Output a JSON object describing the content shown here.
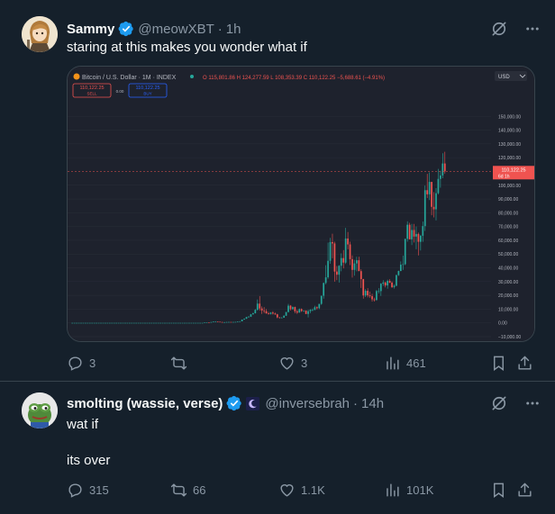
{
  "tweets": [
    {
      "display_name": "Sammy",
      "handle": "@meowXBT",
      "time": "1h",
      "text": "staring at this makes you wonder what if",
      "actions": {
        "replies": "3",
        "retweets": "",
        "likes": "3",
        "views": "461"
      }
    },
    {
      "display_name": "smolting (wassie, verse)",
      "handle": "@inversebrah",
      "time": "14h",
      "text": "wat if\n\nits over",
      "actions": {
        "replies": "315",
        "retweets": "66",
        "likes": "1.1K",
        "views": "101K"
      }
    }
  ],
  "chart_embed": {
    "symbol": "Bitcoin / U.S. Dollar · 1M · INDEX",
    "ohlc": "O 115,801.86  H 124,277.59  L 108,353.39  C 110,122.25  −5,688.61 (−4.91%)",
    "sell_price": "110,122.25",
    "sell_label": "SELL",
    "spread": "0.00",
    "buy_price": "110,122.25",
    "buy_label": "BUY",
    "currency": "USD",
    "current_price_label": "110,122.25",
    "countdown": "6d 1h",
    "y_ticks": [
      "150,000.00",
      "140,000.00",
      "130,000.00",
      "120,000.00",
      "100,000.00",
      "90,000.00",
      "80,000.00",
      "70,000.00",
      "60,000.00",
      "50,000.00",
      "40,000.00",
      "30,000.00",
      "20,000.00",
      "10,000.00",
      "0.00",
      "−10,000.00"
    ]
  },
  "chart_data": {
    "type": "candlestick",
    "title": "Bitcoin / U.S. Dollar · 1M · INDEX",
    "ylim": [
      -10000,
      160000
    ],
    "y_ticks": [
      150000,
      140000,
      130000,
      120000,
      100000,
      90000,
      80000,
      70000,
      60000,
      50000,
      40000,
      30000,
      20000,
      10000,
      0,
      -10000
    ],
    "current_price": 110122.25,
    "candles": [
      [
        0,
        0,
        0,
        0
      ],
      [
        0,
        0,
        0,
        0
      ],
      [
        0,
        0,
        0,
        0
      ],
      [
        0,
        0,
        0,
        0
      ],
      [
        0,
        0,
        0,
        0
      ],
      [
        0,
        0,
        0,
        0
      ],
      [
        0,
        0,
        0,
        0
      ],
      [
        0,
        0,
        0,
        0
      ],
      [
        0,
        0,
        0,
        0
      ],
      [
        0,
        0,
        0,
        0
      ],
      [
        0,
        0,
        0,
        0
      ],
      [
        0,
        0,
        0,
        0
      ],
      [
        0,
        0,
        0,
        0
      ],
      [
        0,
        0,
        0,
        0
      ],
      [
        0,
        0,
        0,
        0
      ],
      [
        0,
        0,
        0,
        0
      ],
      [
        0,
        0,
        0,
        0
      ],
      [
        0,
        0,
        0,
        0
      ],
      [
        0,
        0,
        0,
        0
      ],
      [
        0,
        0,
        0,
        0
      ],
      [
        0,
        0,
        0,
        0
      ],
      [
        0,
        0,
        0,
        0
      ],
      [
        0,
        0,
        0,
        0
      ],
      [
        0,
        0,
        0,
        0
      ],
      [
        0,
        0,
        0,
        0
      ],
      [
        0,
        0,
        0,
        0
      ],
      [
        0,
        0,
        0,
        0
      ],
      [
        0,
        0,
        0,
        0
      ],
      [
        0,
        0,
        0,
        0
      ],
      [
        0,
        0,
        0,
        0
      ],
      [
        0,
        0,
        0,
        0
      ],
      [
        0,
        0,
        0,
        0
      ],
      [
        0,
        0,
        0,
        0
      ],
      [
        0,
        0,
        0,
        0
      ],
      [
        0,
        0,
        0,
        0
      ],
      [
        0,
        0,
        0,
        0
      ],
      [
        0,
        0,
        0,
        0
      ],
      [
        0,
        0,
        0,
        0
      ],
      [
        0,
        0,
        0,
        0
      ],
      [
        0,
        0,
        0,
        0
      ],
      [
        0,
        0,
        0,
        0
      ],
      [
        0,
        0,
        0,
        0
      ],
      [
        0,
        0,
        0,
        0
      ],
      [
        0,
        0,
        0,
        0
      ],
      [
        0,
        0,
        0,
        0
      ],
      [
        0,
        0,
        0,
        0
      ],
      [
        0,
        0,
        0,
        0
      ],
      [
        0,
        0,
        0,
        0
      ],
      [
        0,
        0,
        0,
        0
      ],
      [
        0,
        0,
        0,
        0
      ],
      [
        0,
        0,
        0,
        0
      ],
      [
        0,
        0,
        0,
        0
      ],
      [
        0,
        0,
        0,
        0
      ],
      [
        0,
        0,
        0,
        0
      ],
      [
        0,
        0,
        0,
        0
      ],
      [
        0,
        0,
        0,
        0
      ],
      [
        0,
        0,
        0,
        0
      ],
      [
        0,
        0,
        0,
        0
      ],
      [
        0,
        0,
        0,
        0
      ],
      [
        0,
        0,
        0,
        0
      ],
      [
        300,
        300,
        300,
        300
      ],
      [
        300,
        400,
        300,
        400
      ],
      [
        400,
        450,
        300,
        350
      ],
      [
        350,
        700,
        350,
        600
      ],
      [
        600,
        1000,
        500,
        900
      ],
      [
        900,
        1200,
        800,
        1000
      ],
      [
        1000,
        1100,
        700,
        800
      ],
      [
        800,
        900,
        500,
        600
      ],
      [
        600,
        700,
        400,
        500
      ],
      [
        500,
        600,
        400,
        500
      ],
      [
        500,
        700,
        400,
        600
      ],
      [
        600,
        700,
        500,
        650
      ],
      [
        650,
        700,
        550,
        600
      ],
      [
        600,
        700,
        550,
        650
      ],
      [
        650,
        800,
        600,
        700
      ],
      [
        700,
        1000,
        650,
        950
      ],
      [
        950,
        1200,
        900,
        1150
      ],
      [
        1150,
        2500,
        1100,
        2400
      ],
      [
        2400,
        3200,
        2300,
        3000
      ],
      [
        3000,
        4500,
        2900,
        4200
      ],
      [
        4200,
        5000,
        3800,
        4500
      ],
      [
        4500,
        6500,
        4300,
        6200
      ],
      [
        6200,
        7500,
        6000,
        7000
      ],
      [
        7000,
        10000,
        6800,
        9500
      ],
      [
        9500,
        17000,
        9000,
        14000
      ],
      [
        14000,
        19500,
        9000,
        10500
      ],
      [
        10500,
        12000,
        6500,
        9000
      ],
      [
        9000,
        11500,
        7000,
        8500
      ],
      [
        8500,
        10000,
        6500,
        7000
      ],
      [
        7000,
        8000,
        6000,
        6500
      ],
      [
        6500,
        7800,
        6000,
        7500
      ],
      [
        7500,
        8500,
        6000,
        6800
      ],
      [
        6800,
        7500,
        5800,
        6200
      ],
      [
        6200,
        6600,
        3400,
        4000
      ],
      [
        4000,
        4200,
        3200,
        3700
      ],
      [
        3700,
        4200,
        3400,
        3800
      ],
      [
        3800,
        5500,
        3700,
        5200
      ],
      [
        5200,
        8000,
        5000,
        7900
      ],
      [
        7900,
        13800,
        7600,
        12500
      ],
      [
        12500,
        13000,
        9000,
        10000
      ],
      [
        10000,
        12000,
        9500,
        11500
      ],
      [
        11500,
        11800,
        7000,
        8400
      ],
      [
        8400,
        9500,
        6500,
        7500
      ],
      [
        7500,
        10500,
        7400,
        10000
      ],
      [
        10000,
        10500,
        8000,
        8600
      ],
      [
        8600,
        9200,
        8100,
        8900
      ],
      [
        8900,
        9200,
        6500,
        6500
      ],
      [
        6500,
        9500,
        4000,
        8500
      ],
      [
        8500,
        10000,
        7000,
        9500
      ],
      [
        9500,
        10500,
        8500,
        9500
      ],
      [
        9500,
        12500,
        9100,
        11400
      ],
      [
        11400,
        12000,
        9800,
        10700
      ],
      [
        10700,
        13800,
        10000,
        13800
      ],
      [
        13800,
        19800,
        13100,
        19700
      ],
      [
        19700,
        29300,
        17600,
        29000
      ],
      [
        29000,
        41900,
        28000,
        33100
      ],
      [
        33100,
        58300,
        32000,
        45100
      ],
      [
        45100,
        61800,
        43000,
        58700
      ],
      [
        58700,
        64800,
        47000,
        57700
      ],
      [
        57700,
        59000,
        30000,
        37300
      ],
      [
        37300,
        41300,
        31000,
        35000
      ],
      [
        35000,
        42000,
        29300,
        41500
      ],
      [
        41500,
        50500,
        37500,
        47100
      ],
      [
        47100,
        52900,
        39600,
        43800
      ],
      [
        43800,
        69000,
        42800,
        61300
      ],
      [
        61300,
        66000,
        53500,
        57000
      ],
      [
        57000,
        59000,
        42000,
        46300
      ],
      [
        46300,
        49000,
        32900,
        38500
      ],
      [
        38500,
        45800,
        34300,
        43200
      ],
      [
        43200,
        48000,
        37500,
        45500
      ],
      [
        45500,
        48000,
        37700,
        37600
      ],
      [
        37600,
        39000,
        25400,
        31800
      ],
      [
        31800,
        32000,
        17600,
        19900
      ],
      [
        19900,
        24600,
        18800,
        23300
      ],
      [
        23300,
        25200,
        18500,
        20000
      ],
      [
        20000,
        22800,
        18200,
        19400
      ],
      [
        19400,
        21100,
        15500,
        17100
      ],
      [
        17100,
        18400,
        15500,
        16500
      ],
      [
        16500,
        23900,
        16500,
        23100
      ],
      [
        23100,
        25200,
        21400,
        23100
      ],
      [
        23100,
        28900,
        19600,
        28500
      ],
      [
        28500,
        31000,
        26900,
        29300
      ],
      [
        29300,
        30000,
        25800,
        27200
      ],
      [
        27200,
        31400,
        24800,
        30500
      ],
      [
        30500,
        31800,
        28900,
        29200
      ],
      [
        29200,
        30200,
        25300,
        26000
      ],
      [
        26000,
        28000,
        24900,
        27000
      ],
      [
        27000,
        35000,
        26600,
        34700
      ],
      [
        34700,
        38000,
        34100,
        37700
      ],
      [
        37700,
        44700,
        37600,
        42300
      ],
      [
        42300,
        48900,
        38500,
        42600
      ],
      [
        42600,
        52000,
        41900,
        61100
      ],
      [
        61100,
        73800,
        59000,
        71300
      ],
      [
        71300,
        72700,
        60800,
        60700
      ],
      [
        60700,
        71900,
        56500,
        67500
      ],
      [
        67500,
        71900,
        58400,
        62700
      ],
      [
        62700,
        70000,
        53500,
        64600
      ],
      [
        64600,
        65600,
        49000,
        58900
      ],
      [
        58900,
        64000,
        52600,
        63300
      ],
      [
        63300,
        73600,
        58900,
        70300
      ],
      [
        70300,
        99800,
        66800,
        96400
      ],
      [
        96400,
        108300,
        90700,
        93400
      ],
      [
        93400,
        109300,
        89200,
        102400
      ],
      [
        102400,
        102500,
        78200,
        84300
      ],
      [
        84300,
        95000,
        76600,
        82500
      ],
      [
        82500,
        97900,
        74400,
        94200
      ],
      [
        94200,
        111900,
        93300,
        104600
      ],
      [
        104600,
        110500,
        98200,
        107100
      ],
      [
        107100,
        123200,
        105100,
        115800
      ],
      [
        115800,
        124300,
        108400,
        110100
      ]
    ]
  }
}
